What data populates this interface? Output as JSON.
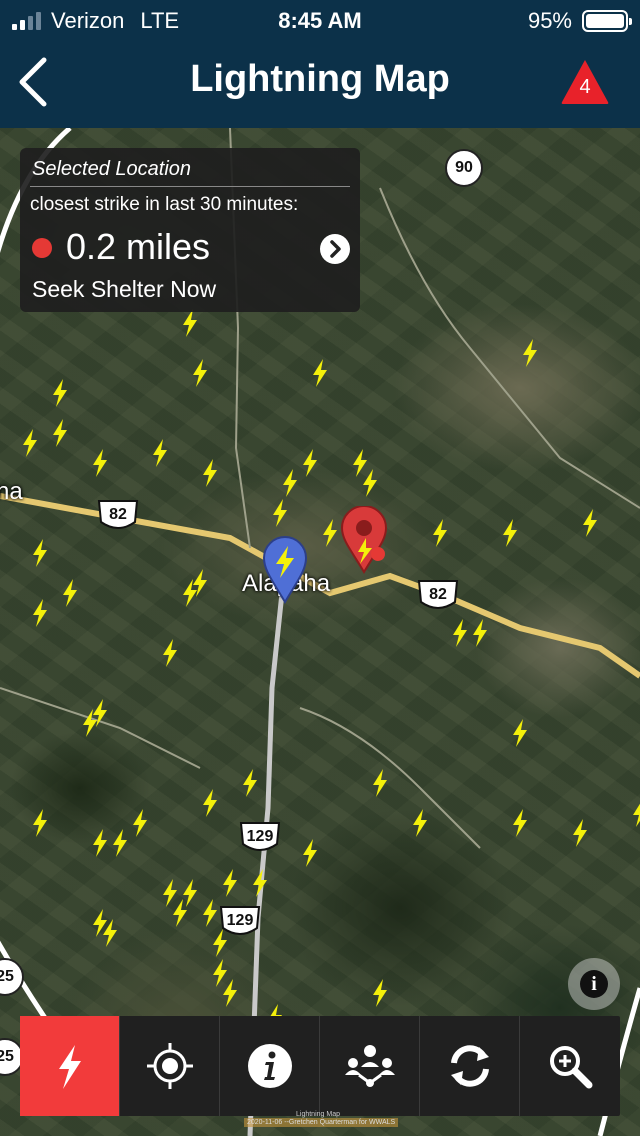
{
  "status_bar": {
    "carrier": "Verizon",
    "network": "LTE",
    "time": "8:45 AM",
    "battery": "95%"
  },
  "nav": {
    "title": "Lightning Map",
    "alert_count": "4"
  },
  "info_card": {
    "title": "Selected Location",
    "subtitle": "closest strike in last 30 minutes:",
    "distance": "0.2  miles",
    "action": "Seek Shelter Now"
  },
  "map": {
    "town_label": "Alapaha",
    "edge_label": "na",
    "routes": {
      "us82_a": "82",
      "us82_b": "82",
      "us129_a": "129",
      "us129_b": "129",
      "sr90": "90",
      "edge_25a": "25",
      "edge_25b": "25"
    },
    "credit_title": "Lightning Map",
    "credit_text": "2020-11-06 --Gretchen Quarterman for WWALS"
  },
  "toolbar": {
    "items": [
      {
        "name": "lightning-tool",
        "icon": "lightning-icon"
      },
      {
        "name": "locate-tool",
        "icon": "crosshair-icon"
      },
      {
        "name": "info-tool",
        "icon": "info-icon"
      },
      {
        "name": "share-tool",
        "icon": "network-icon"
      },
      {
        "name": "refresh-tool",
        "icon": "refresh-icon"
      },
      {
        "name": "zoom-tool",
        "icon": "zoom-in-icon"
      }
    ]
  },
  "colors": {
    "header": "#0c3149",
    "accent_red": "#f23b3b",
    "bolt": "#f4f00a",
    "toolbar": "#202020"
  }
}
